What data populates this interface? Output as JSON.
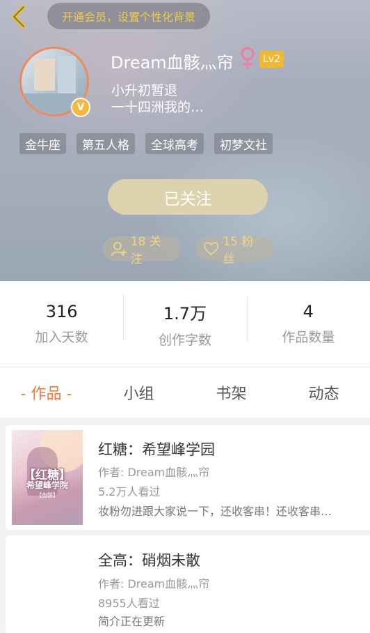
{
  "header": {
    "vip_prompt": "开通会员，设置个性化背景",
    "username": "Dream血骸灬帘",
    "gender_symbol": "♀",
    "level": "Lv2",
    "verified_badge": "V",
    "bio_lines": [
      "小升初暂退",
      "一十四洲我的…"
    ],
    "tags": [
      "金牛座",
      "第五人格",
      "全球高考",
      "初梦文社"
    ],
    "follow_button": "已关注",
    "following": "18 关注",
    "fans": "15 粉丝"
  },
  "stats": [
    {
      "value": "316",
      "label": "加入天数"
    },
    {
      "value": "1.7万",
      "label": "创作字数"
    },
    {
      "value": "4",
      "label": "作品数量"
    }
  ],
  "tabs": [
    "- 作品 -",
    "小组",
    "书架",
    "动态"
  ],
  "works": [
    {
      "title": "红糖：希望峰学园",
      "author": "作者: Dream血骸灬帘",
      "views": "5.2万人看过",
      "desc": "妆粉勿进跟大家说一下，还收客串！还收客串…",
      "cover_text": [
        "【红糖】",
        "希望峰学院",
        "【血骸】"
      ]
    },
    {
      "title": "全高：硝烟未散",
      "author": "作者: Dream血骸灬帘",
      "views": "8955人看过",
      "desc": "简介正在更新"
    }
  ],
  "colors": {
    "accent": "#f07a3d",
    "vip_text": "#f2cb4a",
    "level_badge": "#f2b730",
    "follow_button": "#ddd2ae",
    "avatar_ring": "#f08b58"
  },
  "icons": [
    "back-arrow-icon",
    "female-icon",
    "person-add-icon",
    "heart-icon"
  ]
}
